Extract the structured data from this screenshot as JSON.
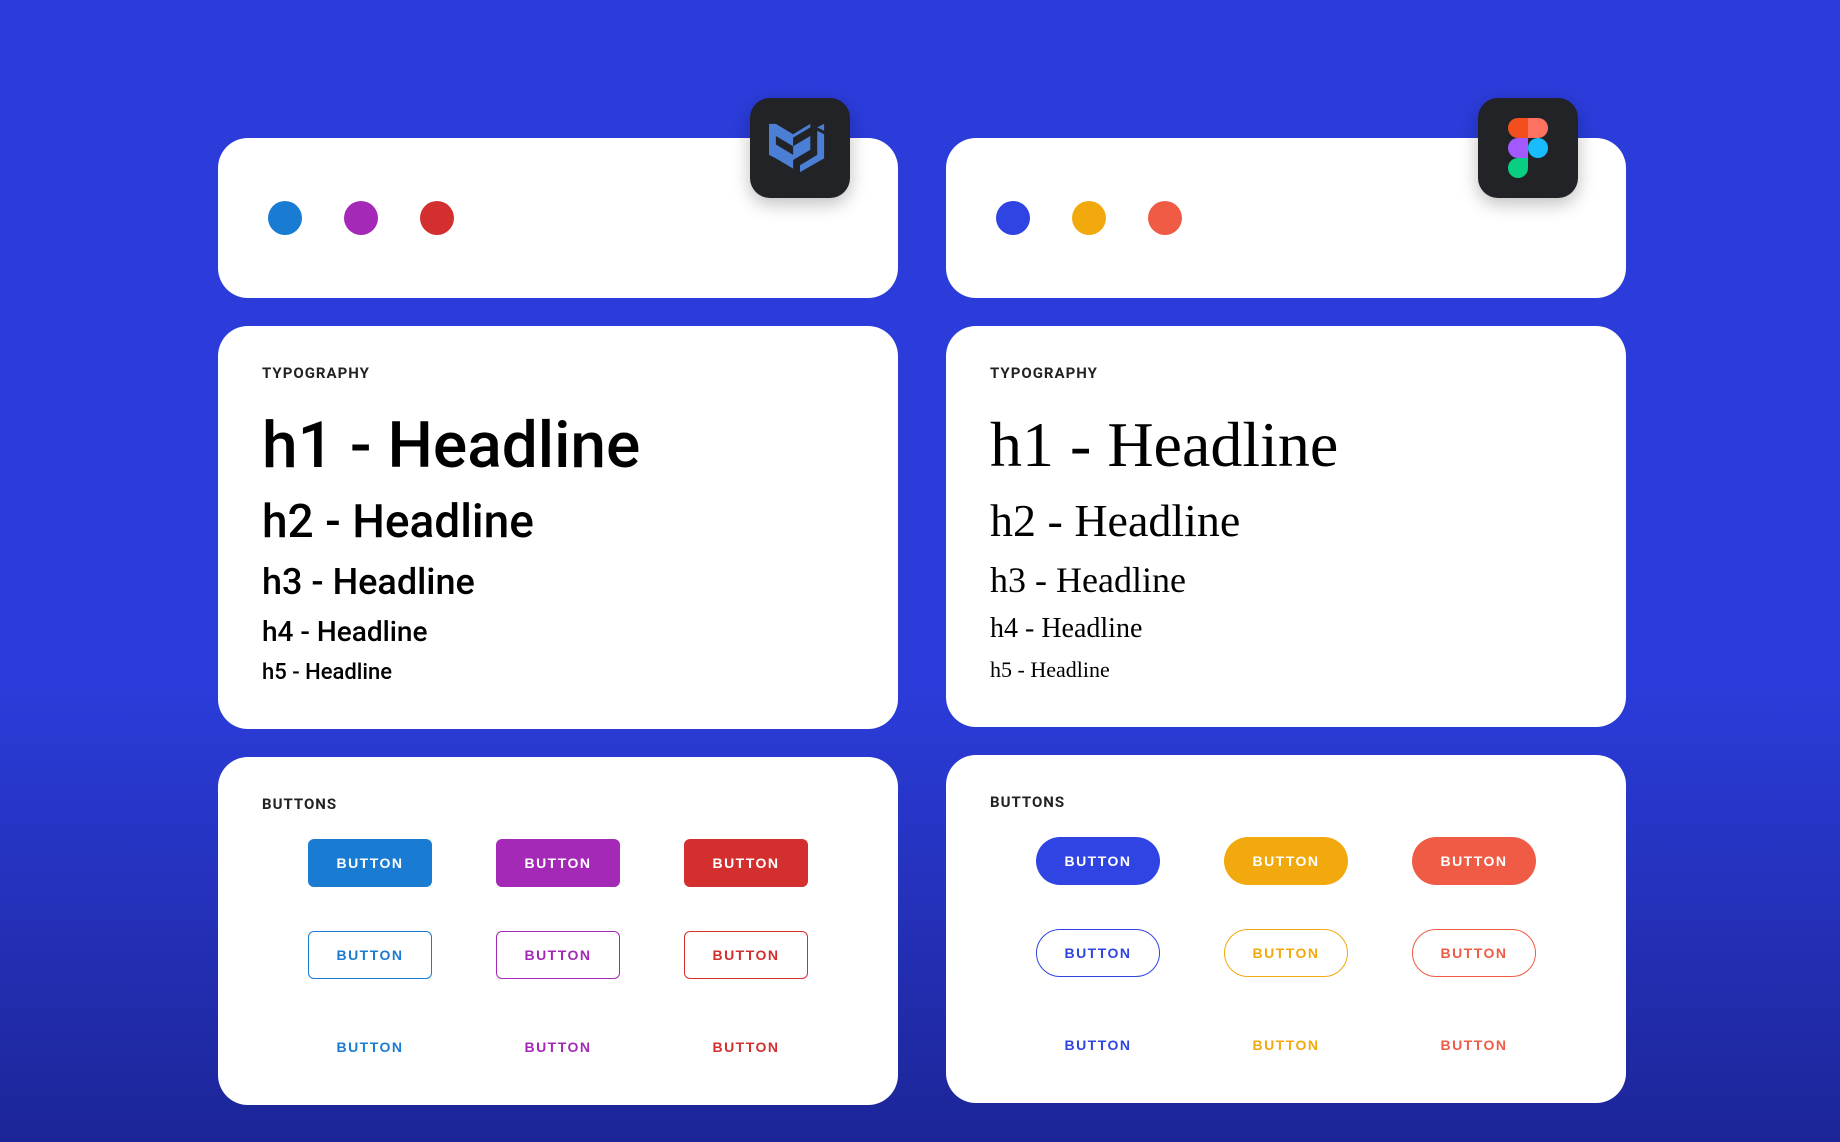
{
  "palettes": {
    "left": {
      "primary": "#197cd2",
      "secondary": "#a429b6",
      "danger": "#d32f2f"
    },
    "right": {
      "primary": "#3044e3",
      "secondary": "#f2a90d",
      "danger": "#ef5b45"
    }
  },
  "tool_badges": {
    "left": {
      "name": "mui-icon",
      "bg": "#222327"
    },
    "right": {
      "name": "figma-icon",
      "bg": "#222327"
    }
  },
  "typography": {
    "section_label": "TYPOGRAPHY",
    "levels": [
      {
        "css": "h1",
        "text": "h1 - Headline"
      },
      {
        "css": "h2",
        "text": "h2 - Headline"
      },
      {
        "css": "h3",
        "text": "h3 - Headline"
      },
      {
        "css": "h4",
        "text": "h4 - Headline"
      },
      {
        "css": "h5",
        "text": "h5 - Headline"
      }
    ]
  },
  "buttons": {
    "section_label": "BUTTONS",
    "label": "BUTTON",
    "variants": [
      "filled",
      "outlined",
      "text"
    ],
    "shape": {
      "left": "rect",
      "right": "pill"
    }
  }
}
